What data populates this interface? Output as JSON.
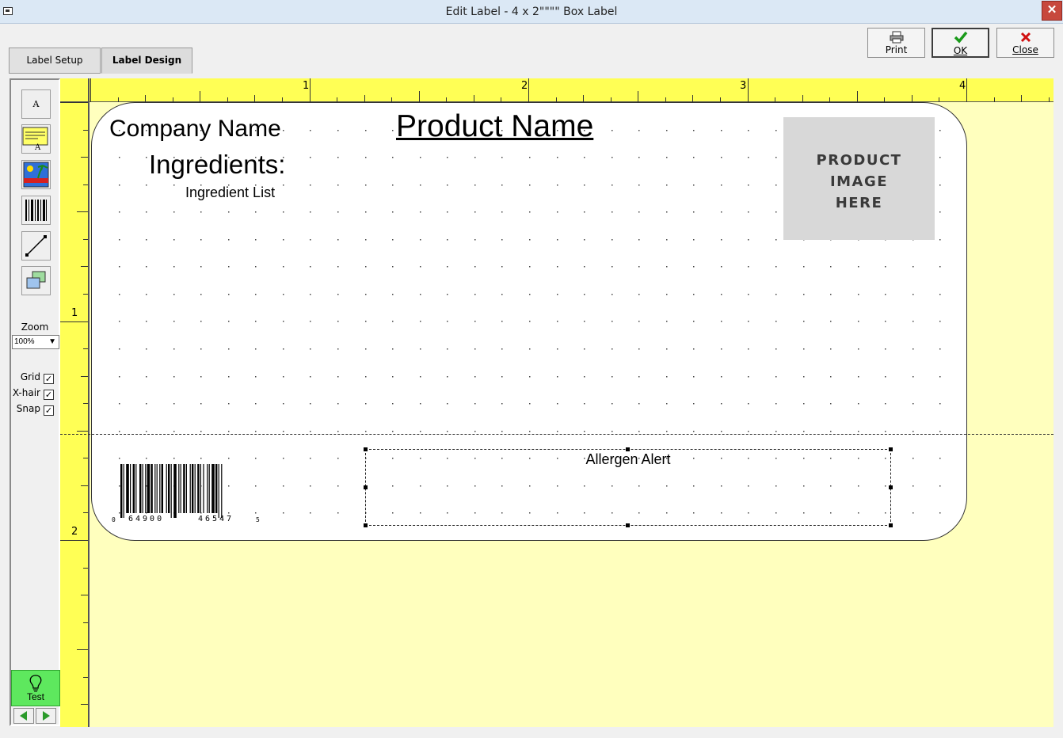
{
  "window": {
    "title": "Edit Label - 4 x 2\"\"\"\" Box Label",
    "close_glyph": "✕"
  },
  "tabs": [
    {
      "label": "Label Setup"
    },
    {
      "label": "Label Design"
    }
  ],
  "toolbar": {
    "print_label": "Print",
    "ok_label": "OK",
    "close_label": "Close",
    "ok_color": "#1a9a1a",
    "close_color": "#d01010"
  },
  "tools": [
    {
      "name": "text-tool",
      "glyph": "A"
    },
    {
      "name": "text-box-tool",
      "glyph": "A"
    },
    {
      "name": "image-tool"
    },
    {
      "name": "barcode-tool"
    },
    {
      "name": "line-tool"
    },
    {
      "name": "shape-tool"
    }
  ],
  "zoom": {
    "label": "Zoom",
    "value": "100%"
  },
  "options": [
    {
      "label": "Grid",
      "checked": true
    },
    {
      "label": "X-hair",
      "checked": true
    },
    {
      "label": "Snap",
      "checked": true
    }
  ],
  "test_label": "Test",
  "rulers": {
    "top_numbers": [
      "1",
      "2",
      "3",
      "4"
    ],
    "left_numbers": [
      "1",
      "2"
    ]
  },
  "label": {
    "company_name": "Company Name",
    "ingredients_heading": "Ingredients:",
    "ingredient_list": "Ingredient List",
    "product_name": "Product Name",
    "product_image_lines": [
      "PRODUCT",
      "IMAGE",
      "HERE"
    ],
    "barcode_digits": {
      "lead": "0",
      "left": "64900",
      "right": "46547",
      "check": "5"
    },
    "allergen_alert": "Allergen Alert"
  },
  "colors": {
    "ruler": "#ffff55",
    "canvas": "#ffffbe",
    "label_background": "#ffffff",
    "test_button": "#5ee85e"
  }
}
